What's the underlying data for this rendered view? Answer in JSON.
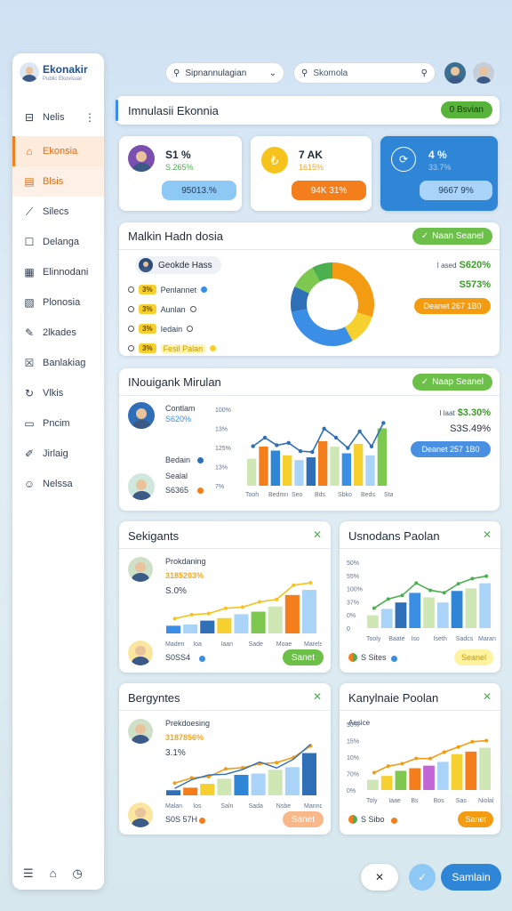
{
  "brand": {
    "name": "Ekonakir",
    "subtitle": "Public Ekovisual"
  },
  "search": {
    "left_value": "Sipnannulagian",
    "right_placeholder": "Skomola"
  },
  "sidebar": {
    "items": [
      {
        "label": "Nelis",
        "icon": "minus-square-icon"
      },
      {
        "label": "Ekonsia",
        "icon": "home-icon"
      },
      {
        "label": "Blsis",
        "icon": "folder-icon"
      },
      {
        "label": "Silecs",
        "icon": "chart-icon"
      },
      {
        "label": "Delanga",
        "icon": "square-icon"
      },
      {
        "label": "Elinnodani",
        "icon": "grid-icon"
      },
      {
        "label": "Plonosia",
        "icon": "image-icon"
      },
      {
        "label": "2lkades",
        "icon": "edit-icon"
      },
      {
        "label": "Banlakiag",
        "icon": "x-box-icon"
      },
      {
        "label": "Vlkis",
        "icon": "refresh-icon"
      },
      {
        "label": "Pncim",
        "icon": "rect-icon"
      },
      {
        "label": "Jirlaig",
        "icon": "pen-icon"
      },
      {
        "label": "Nelssa",
        "icon": "user-icon"
      }
    ],
    "more": "⋮"
  },
  "header": {
    "title": "Imnulasii Ekonnia",
    "button": "0 Bsvian"
  },
  "stats": [
    {
      "value": "S1 %",
      "sub": "S.265%",
      "pill": "95013.%",
      "accent": "#1f2a37"
    },
    {
      "value": "7 AK",
      "sub": "1615%",
      "pill": "94K 31%",
      "accent": "#f5a623"
    },
    {
      "value": "4 %",
      "sub": "33.7%",
      "pill": "9667 9%",
      "accent": "#ffffff"
    }
  ],
  "donut_card": {
    "title": "Malkin Hadn dosia",
    "button": "Naan Seanel",
    "chip": "Geokde Hass",
    "legend": [
      {
        "tag": "3%",
        "label": "Penlannet"
      },
      {
        "tag": "3%",
        "label": "Aunlan"
      },
      {
        "tag": "3%",
        "label": "Iedain"
      },
      {
        "tag": "3%",
        "label": "Fesil Palan"
      }
    ],
    "values": [
      "S620%",
      "S573%"
    ],
    "value_prefix": "I ased",
    "orange_pill": "Deanet 267 1B0"
  },
  "line_card": {
    "title": "INouigank Mirulan",
    "button": "Naap Seanel",
    "people": [
      {
        "name": "Contlam",
        "value": "S620%"
      },
      {
        "name": "Bedain",
        "value": ""
      },
      {
        "name": "Sealal",
        "value": "S6365"
      }
    ],
    "values": [
      "$3.30%",
      "S3S.49%"
    ],
    "value_prefix": "I laat",
    "blue_pill": "Deanet 257 1B0",
    "y_ticks": [
      "100%",
      "13%",
      "125%",
      "13%",
      "7%"
    ],
    "x_ticks": [
      "Tooh",
      "Bedmn",
      "Seo",
      "Bds",
      "Sbko",
      "Beds",
      "Stab"
    ]
  },
  "small_cards": [
    {
      "title": "Sekigants",
      "person": "Prokdaning",
      "values": [
        "3185203%",
        "S.0%"
      ],
      "footer": "S0SS4",
      "btn": "Sanet",
      "x_ticks": [
        "Maden",
        "Ioa",
        "Iaan",
        "Sade",
        "Moae",
        "Marelse"
      ]
    },
    {
      "title": "Usnodans Paolan",
      "person": "",
      "values": [],
      "footer": "S Sites",
      "btn": "Seanel",
      "x_ticks": [
        "Tooly",
        "Baate",
        "Iso",
        "Iseth",
        "Sadcs",
        "Maranise"
      ],
      "y_ticks": [
        "50%",
        "55%",
        "100%",
        "37%",
        "0%",
        "0"
      ]
    },
    {
      "title": "Bergyntes",
      "person": "Prekdoesing",
      "values": [
        "3187856%",
        "3.1%"
      ],
      "footer": "S0S 57H",
      "btn": "Sanet",
      "x_ticks": [
        "Malan",
        "Ios",
        "Saln",
        "Sada",
        "Nsbe",
        "Mannde"
      ]
    },
    {
      "title": "Kanylnaie Poolan",
      "person": "Aesice",
      "values": [],
      "footer": "S Sibo",
      "btn": "Sanet",
      "x_ticks": [
        "Toly",
        "Iaae",
        "Bs",
        "Bos",
        "Sas",
        "Niolal"
      ],
      "y_ticks": [
        "50%",
        "15%",
        "10%",
        "70%",
        "0%"
      ]
    }
  ],
  "footer": {
    "cancel": "✕",
    "confirm": "✓",
    "save": "Samlain"
  },
  "chart_data": [
    {
      "type": "bar",
      "title": "INouigank Mirulan",
      "categories": [
        "Tooh",
        "Bedmn",
        "Seo",
        "Bds",
        "Sbko",
        "Beds",
        "Stab"
      ],
      "series": [
        {
          "values": [
            40,
            58,
            52,
            45,
            38,
            42,
            66,
            58,
            48,
            62,
            45,
            85
          ]
        }
      ],
      "ylim": [
        0,
        100
      ]
    },
    {
      "type": "pie",
      "title": "Malkin Hadn dosia",
      "values": [
        30,
        12,
        30,
        10,
        10,
        8
      ],
      "colors": [
        "#f39c12",
        "#f6d02f",
        "#3a8ee6",
        "#2f6fb8",
        "#7ec850",
        "#4caf50"
      ]
    }
  ]
}
